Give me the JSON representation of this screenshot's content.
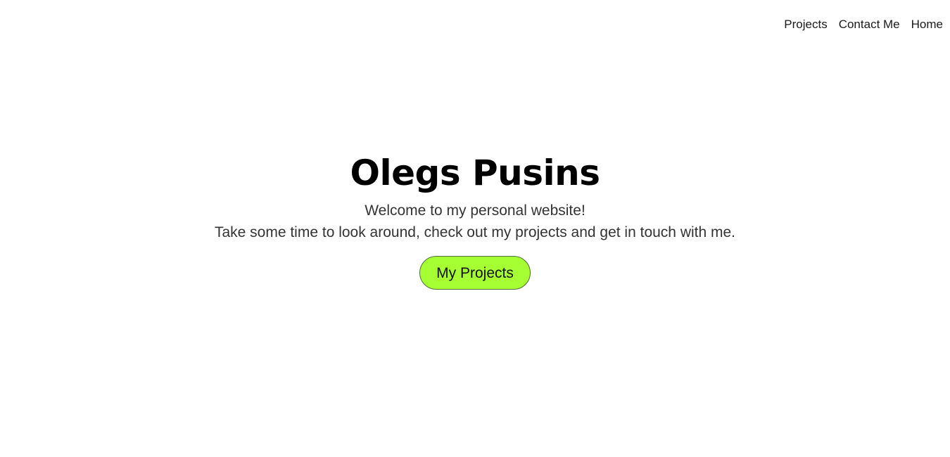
{
  "nav": {
    "items": [
      {
        "label": "Projects"
      },
      {
        "label": "Contact Me"
      },
      {
        "label": "Home"
      }
    ]
  },
  "hero": {
    "title": "Olegs Pusins",
    "subtitle_line1": "Welcome to my personal website!",
    "subtitle_line2": "Take some time to look around, check out my projects and get in touch with me.",
    "cta_label": "My Projects"
  },
  "colors": {
    "cta_background": "#a6ff33",
    "cta_border": "#4f6a3a",
    "page_background": "#ffffff"
  }
}
